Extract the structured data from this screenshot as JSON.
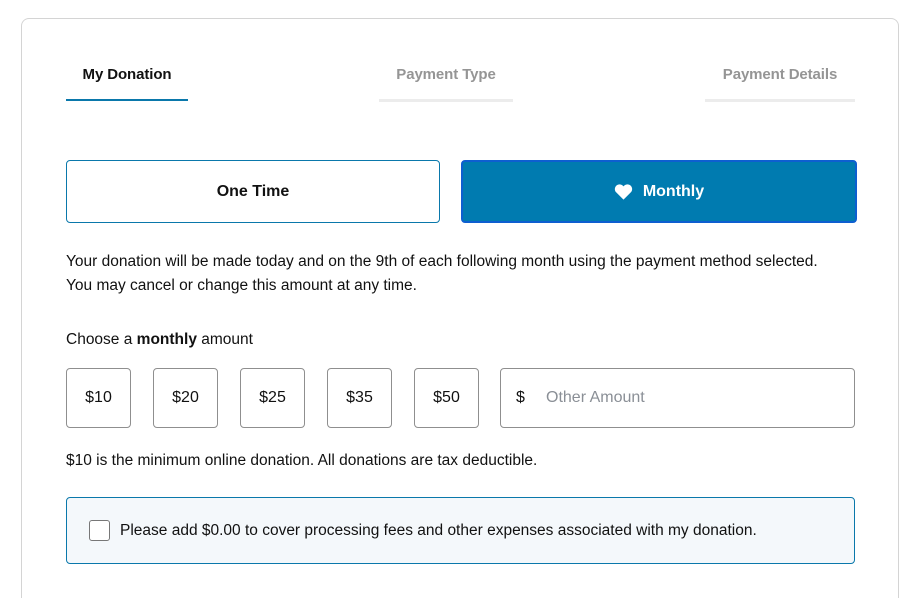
{
  "steps": [
    {
      "label": "My Donation",
      "state": "active"
    },
    {
      "label": "Payment Type",
      "state": "inactive"
    },
    {
      "label": "Payment Details",
      "state": "inactive"
    }
  ],
  "frequency": {
    "one_time_label": "One Time",
    "monthly_label": "Monthly",
    "monthly_icon": "heart-icon",
    "selected": "Monthly"
  },
  "info_text": {
    "line1": "Your donation will be made today and on the 9th of each following month using the payment method selected.",
    "line2": "You may cancel or change this amount at any time."
  },
  "choose": {
    "prefix": "Choose a",
    "emphasis": "monthly",
    "suffix": "amount"
  },
  "amounts": [
    "$10",
    "$20",
    "$25",
    "$35",
    "$50"
  ],
  "other_amount": {
    "currency_symbol": "$",
    "placeholder": "Other Amount",
    "value": ""
  },
  "minimum_text": "$10 is the minimum online donation. All donations are tax deductible.",
  "fee_cover": {
    "label": "Please add $0.00 to cover processing fees and other expenses associated with my donation.",
    "checked": false
  },
  "colors": {
    "accent": "#007bb0",
    "accent_border": "#0a78ab",
    "fee_box_bg": "#f4f8fb",
    "inactive_step_text": "#959595"
  }
}
